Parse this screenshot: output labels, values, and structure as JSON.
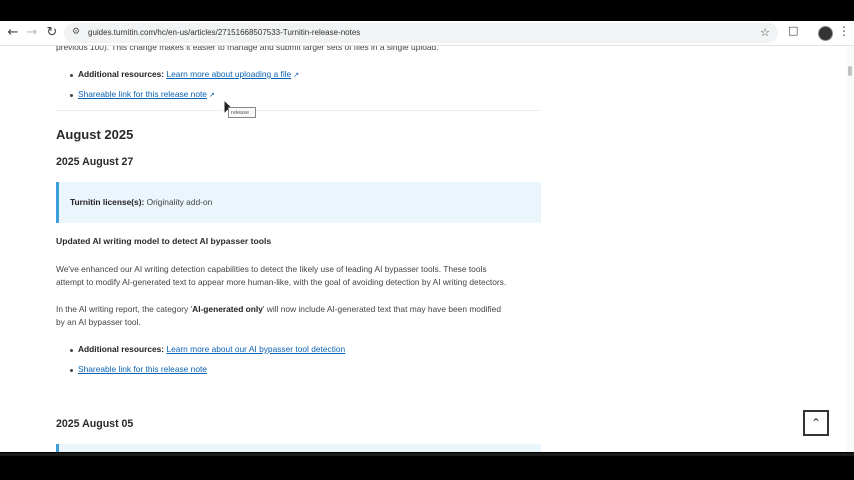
{
  "browser": {
    "url": "guides.turnitin.com/hc/en-us/articles/27151668507533-Turnitin-release-notes",
    "back_icon": "arrow-left-icon",
    "forward_icon": "arrow-right-icon",
    "reload_icon": "reload-icon"
  },
  "article": {
    "top_partial_text": "previous 100). This change makes it easier to manage and submit larger sets of files in a single upload.",
    "section1": {
      "resources_label": "Additional resources:",
      "resources_link": "Learn more about uploading a file",
      "share_link": "Shareable link for this release note"
    },
    "tooltip_text": "release",
    "month_heading": "August 2025",
    "date_heading_1": "2025 August 27",
    "callout": {
      "label": "Turnitin license(s):",
      "value": "Originality add-on"
    },
    "feature_title": "Updated AI writing model to detect AI bypasser tools",
    "para1_line1": "We've enhanced our AI writing detection capabilities to detect the likely use of leading AI bypasser tools. These tools",
    "para1_line2": "attempt to modify AI-generated text to appear more human-like, with the goal of avoiding detection by AI writing detectors.",
    "para2_prefix": "In the AI writing report, the category '",
    "para2_bold": "AI-generated only",
    "para2_suffix": "' will now include AI-generated text that may have been modified",
    "para2_line2": "by an AI bypasser tool.",
    "section2": {
      "resources_label": "Additional resources:",
      "resources_link": "Learn more about our AI bypasser tool detection",
      "share_link": "Shareable link for this release note"
    },
    "date_heading_2": "2025 August 05"
  },
  "back_to_top_icon": "chevron-up-icon"
}
